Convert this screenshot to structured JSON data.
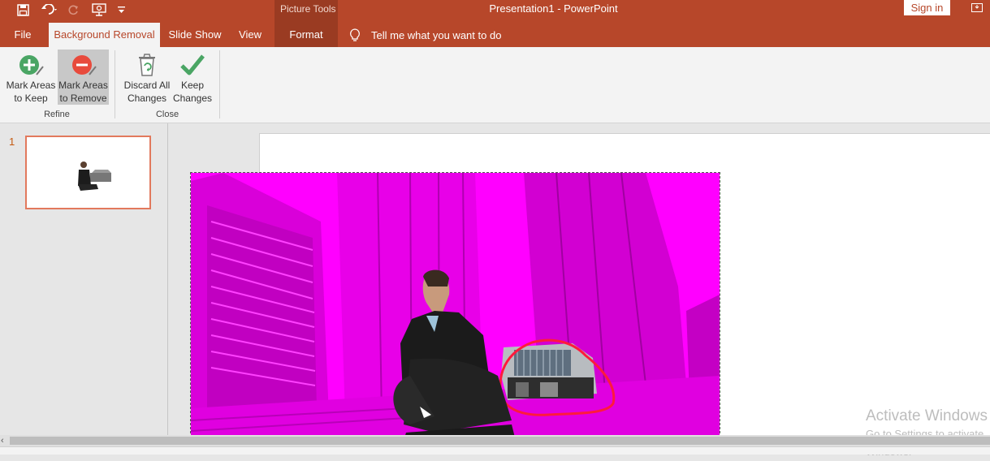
{
  "window": {
    "title": "Presentation1  -  PowerPoint",
    "sign_in": "Sign in"
  },
  "contextual_tab_group": "Picture Tools",
  "tabs": [
    {
      "label": "File"
    },
    {
      "label": "Background Removal"
    },
    {
      "label": "Slide Show"
    },
    {
      "label": "View"
    },
    {
      "label": "Format"
    }
  ],
  "tell_me": "Tell me what you want to do",
  "ribbon": {
    "refine": {
      "label": "Refine",
      "mark_keep": [
        "Mark Areas",
        "to Keep"
      ],
      "mark_remove": [
        "Mark Areas",
        "to Remove"
      ]
    },
    "close": {
      "label": "Close",
      "discard": [
        "Discard All",
        "Changes"
      ],
      "keep": [
        "Keep",
        "Changes"
      ]
    }
  },
  "slides": {
    "current": "1"
  },
  "watermark": {
    "line1": "Activate Windows",
    "line2": "Go to Settings to activate Windows."
  },
  "colors": {
    "brand": "#b7472a",
    "removal_overlay": "#ff00ff",
    "mark_stroke": "#ff1a3c",
    "keep_green": "#4aa564",
    "remove_red": "#e84a3c"
  }
}
